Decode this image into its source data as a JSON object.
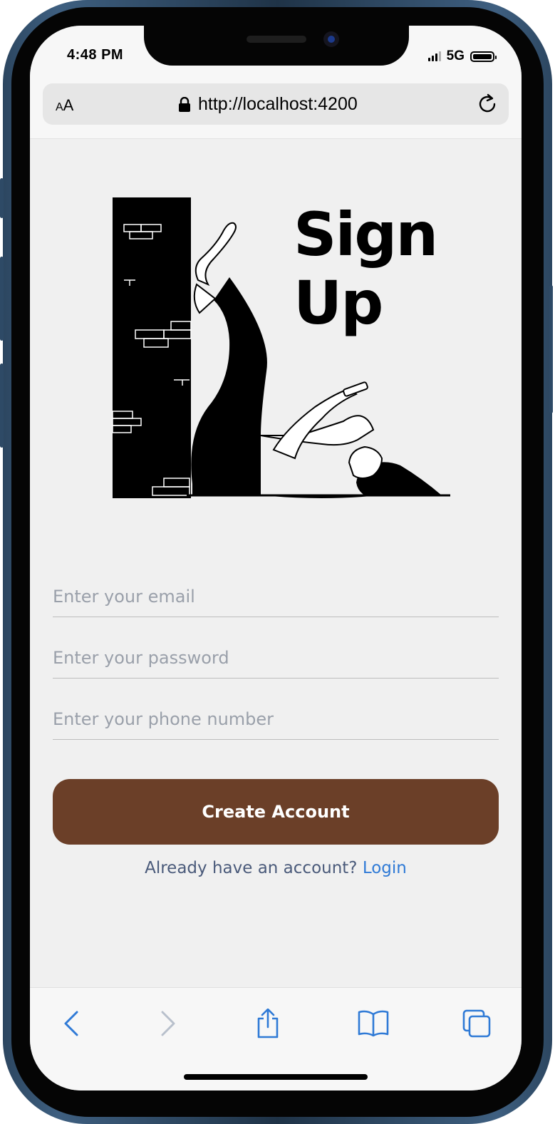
{
  "status_bar": {
    "time": "4:48 PM",
    "network": "5G"
  },
  "browser": {
    "aa_label_small": "A",
    "aa_label_large": "A",
    "url": "http://localhost:4200"
  },
  "page": {
    "title_line1": "Sign",
    "title_line2": "Up",
    "email_placeholder": "Enter your email",
    "password_placeholder": "Enter your password",
    "phone_placeholder": "Enter your phone number",
    "create_button": "Create Account",
    "login_prompt": "Already have an account?",
    "login_link": "Login"
  },
  "icons": {
    "lock": "lock-icon",
    "reload": "reload-icon",
    "back": "chevron-left-icon",
    "forward": "chevron-right-icon",
    "share": "share-icon",
    "bookmarks": "book-icon",
    "tabs": "tabs-icon"
  },
  "colors": {
    "primary_button": "#6b3f28",
    "link": "#2f7ad6",
    "toolbar_icon": "#2f7ad6",
    "background": "#f0f0f0"
  }
}
